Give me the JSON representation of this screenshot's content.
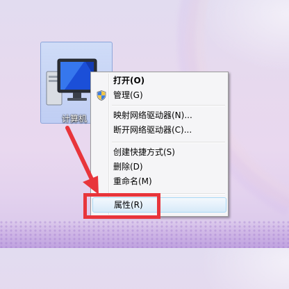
{
  "desktop": {
    "icon_label": "计算机"
  },
  "context_menu": {
    "items": [
      {
        "label": "打开(O)"
      },
      {
        "label": "管理(G)"
      },
      {
        "label": "映射网络驱动器(N)..."
      },
      {
        "label": "断开网络驱动器(C)..."
      },
      {
        "label": "创建快捷方式(S)"
      },
      {
        "label": "删除(D)"
      },
      {
        "label": "重命名(M)"
      },
      {
        "label": "属性(R)"
      }
    ],
    "highlighted_item": "属性(R)"
  },
  "colors": {
    "annotation": "#e8353b",
    "hover_border": "#a8d8f5"
  }
}
